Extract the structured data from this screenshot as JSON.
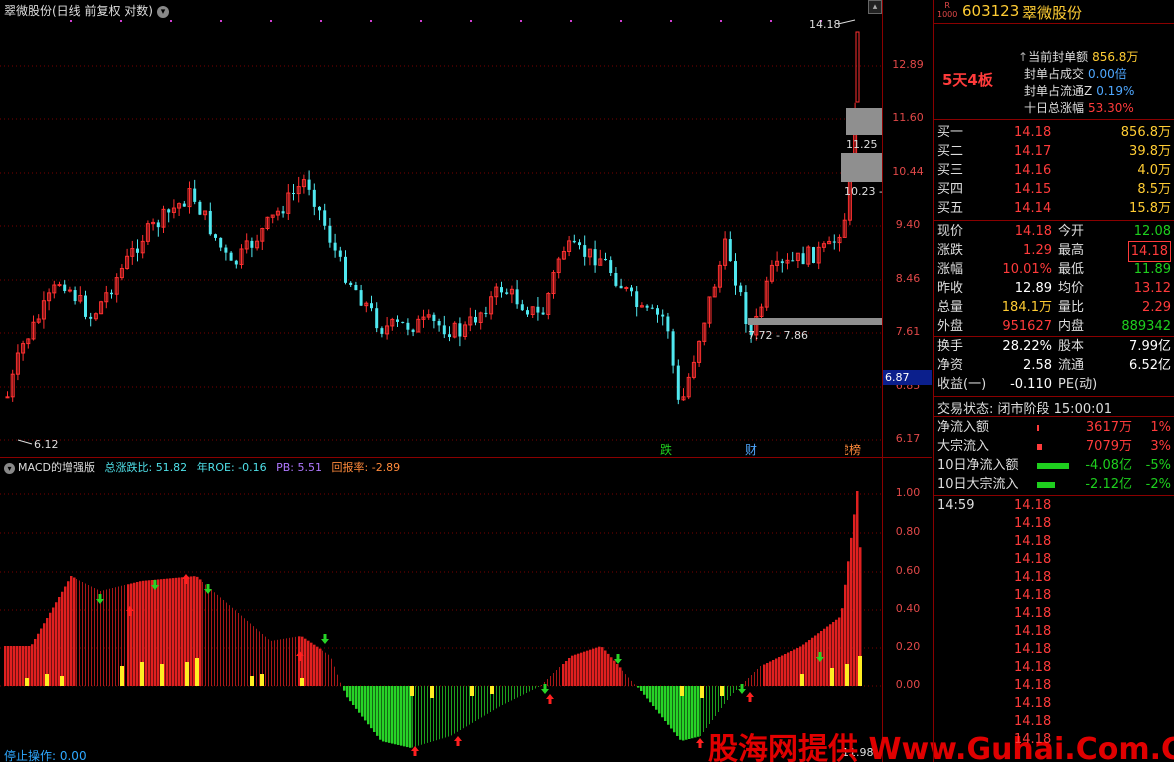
{
  "price_pane": {
    "title": "翠微股份(日线 前复权 对数)",
    "y_labels": [
      "12.89",
      "11.60",
      "10.44",
      "9.40",
      "8.46",
      "7.61",
      "6.85",
      "6.17"
    ],
    "current_tag": "6.87",
    "hi_note": "14.18",
    "lo_note": "6.12",
    "band_labels": [
      "11.25",
      "10.23",
      "7.72 - 7.86"
    ],
    "events": [
      {
        "text": "跌",
        "color": "#1ecf1e"
      },
      {
        "text": "财",
        "color": "#4fa8ff"
      },
      {
        "text": "龙虎榜",
        "color": "#ff8a3b"
      }
    ]
  },
  "indicator_pane": {
    "name": "MACD的增强版",
    "stats": [
      {
        "label": "总涨跌比: ",
        "value": "51.82",
        "color": "#4fe0e8"
      },
      {
        "label": "年ROE: ",
        "value": "-0.16",
        "color": "#4fe0e8"
      },
      {
        "label": "PB: ",
        "value": "5.51",
        "color": "#b078ff"
      },
      {
        "label": "回报率: ",
        "value": "-2.89",
        "color": "#ff8a3b"
      }
    ],
    "y_labels": [
      "1.00",
      "0.80",
      "0.60",
      "0.40",
      "0.20",
      "0.00"
    ],
    "bottom_note": "11.98",
    "stop_op": "停止操作: 0.00"
  },
  "watermark": "股海网提供 Www.Guhai.Com.CN",
  "side": {
    "badge_top": "R",
    "badge_bottom": "1000",
    "code": "603123",
    "name": "翠微股份",
    "seal_status": "5天4板",
    "seal_rows": [
      {
        "label": "当前封单额",
        "value": "856.8万",
        "color": "#ffcc33"
      },
      {
        "label": "封单占成交",
        "value": "0.00倍",
        "color": "#4fa8ff"
      },
      {
        "label": "封单占流通Z",
        "value": "0.19%",
        "color": "#4fa8ff"
      },
      {
        "label": "十日总涨幅",
        "value": "53.30%",
        "color": "#ff3b3b"
      }
    ],
    "order_book": [
      {
        "label": "买一",
        "price": "14.18",
        "vol": "856.8万"
      },
      {
        "label": "买二",
        "price": "14.17",
        "vol": "39.8万"
      },
      {
        "label": "买三",
        "price": "14.16",
        "vol": "4.0万"
      },
      {
        "label": "买四",
        "price": "14.15",
        "vol": "8.5万"
      },
      {
        "label": "买五",
        "price": "14.14",
        "vol": "15.8万"
      }
    ],
    "quote": [
      {
        "l1": "现价",
        "v1": "14.18",
        "c1": "#ff3b3b",
        "l2": "今开",
        "v2": "12.08",
        "c2": "#1ecf1e"
      },
      {
        "l1": "涨跌",
        "v1": "1.29",
        "c1": "#ff3b3b",
        "l2": "最高",
        "v2": "14.18",
        "c2": "#ff3b3b",
        "boxed": true
      },
      {
        "l1": "涨幅",
        "v1": "10.01%",
        "c1": "#ff3b3b",
        "l2": "最低",
        "v2": "11.89",
        "c2": "#1ecf1e"
      },
      {
        "l1": "昨收",
        "v1": "12.89",
        "c1": "#ffffff",
        "l2": "均价",
        "v2": "13.12",
        "c2": "#ff3b3b"
      },
      {
        "l1": "总量",
        "v1": "184.1万",
        "c1": "#ffcc33",
        "l2": "量比",
        "v2": "2.29",
        "c2": "#ff3b3b"
      },
      {
        "l1": "外盘",
        "v1": "951627",
        "c1": "#ff3b3b",
        "l2": "内盘",
        "v2": "889342",
        "c2": "#1ecf1e"
      }
    ],
    "quote2": [
      {
        "l1": "换手",
        "v1": "28.22%",
        "c1": "#ffffff",
        "l2": "股本",
        "v2": "7.99亿",
        "c2": "#ffffff"
      },
      {
        "l1": "净资",
        "v1": "2.58",
        "c1": "#ffffff",
        "l2": "流通",
        "v2": "6.52亿",
        "c2": "#ffffff"
      },
      {
        "l1": "收益(一)",
        "v1": "-0.110",
        "c1": "#ffffff",
        "l2": "PE(动)",
        "v2": "",
        "c2": "#ffffff"
      }
    ],
    "trade_status": "交易状态: 闭市阶段 15:00:01",
    "flows": [
      {
        "label": "净流入额",
        "value": "3617万",
        "pct": "1%",
        "color": "#ff3b3b"
      },
      {
        "label": "大宗流入",
        "value": "7079万",
        "pct": "3%",
        "color": "#ff3b3b"
      },
      {
        "label": "10日净流入额",
        "value": "-4.08亿",
        "pct": "-5%",
        "color": "#1ecf1e"
      },
      {
        "label": "10日大宗流入",
        "value": "-2.12亿",
        "pct": "-2%",
        "color": "#1ecf1e"
      }
    ],
    "ticks_time": "14:59",
    "tick_price": "14.18"
  }
}
